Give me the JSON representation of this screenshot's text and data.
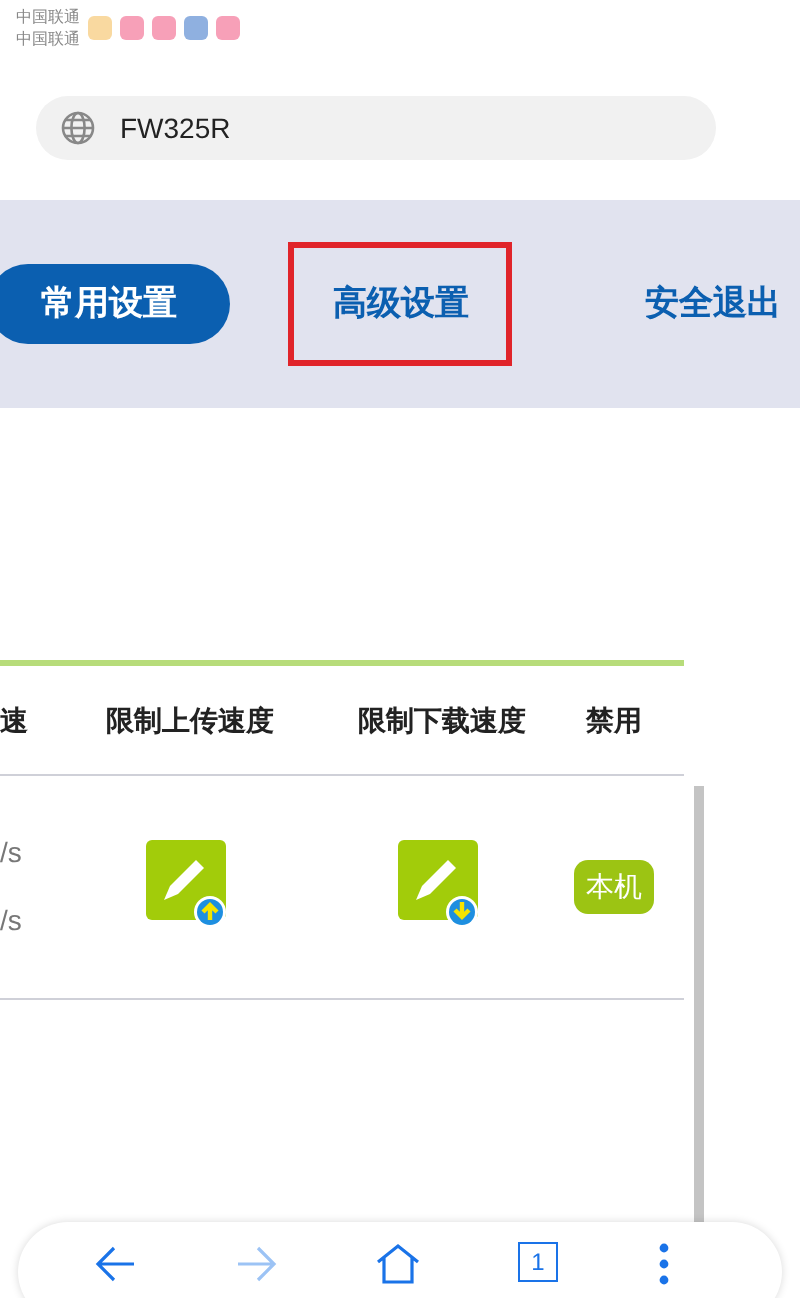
{
  "status_bar": {
    "carriers": [
      "中国联通",
      "中国联通"
    ]
  },
  "address_bar": {
    "value": "FW325R"
  },
  "nav_tabs": [
    {
      "label": "常用设置",
      "selected": true,
      "highlighted": false
    },
    {
      "label": "高级设置",
      "selected": false,
      "highlighted": true
    },
    {
      "label": "安全退出",
      "selected": false,
      "highlighted": false
    }
  ],
  "table": {
    "columns": [
      "速",
      "限制上传速度",
      "限制下载速度",
      "禁用"
    ],
    "rows": [
      {
        "column_1": [
          "/s",
          "/s"
        ],
        "upload_limit": {
          "kind": "upload"
        },
        "download_limit": {
          "kind": "download"
        },
        "disable": "本机"
      }
    ]
  },
  "browser_toolbar": {
    "tab_count": "1"
  }
}
